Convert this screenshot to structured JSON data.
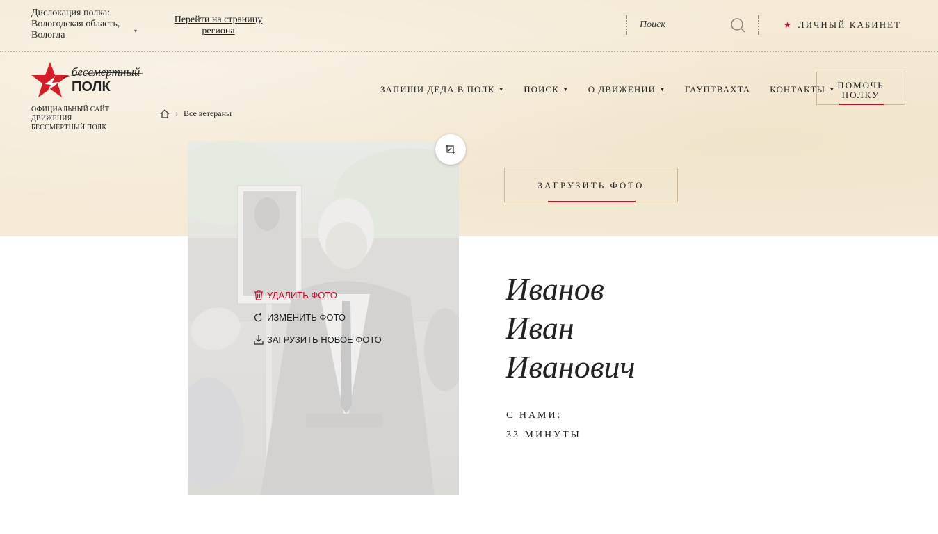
{
  "header": {
    "location_label": "Дислокация полка:",
    "location_value": "Вологодская область, Вологда",
    "region_link": "Перейти на страницу региона",
    "search_placeholder": "Поиск",
    "cabinet": "ЛИЧНЫЙ КАБИНЕТ"
  },
  "logo": {
    "title_line1": "бессмертный",
    "title_line2": "ПОЛК",
    "subtitle_line1": "ОФИЦИАЛЬНЫЙ САЙТ ДВИЖЕНИЯ",
    "subtitle_line2": "БЕССМЕРТНЫЙ ПОЛК"
  },
  "breadcrumb": {
    "current": "Все ветераны"
  },
  "nav": {
    "items": [
      {
        "label": "ЗАПИШИ ДЕДА В ПОЛК",
        "dropdown": true
      },
      {
        "label": "ПОИСК",
        "dropdown": true
      },
      {
        "label": "О ДВИЖЕНИИ",
        "dropdown": true
      },
      {
        "label": "ГАУПТВАХТА",
        "dropdown": false
      },
      {
        "label": "КОНТАКТЫ",
        "dropdown": true
      }
    ],
    "help_line1": "ПОМОЧЬ",
    "help_line2": "ПОЛКУ"
  },
  "photo": {
    "actions": {
      "delete": "УДАЛИТЬ ФОТО",
      "change": "ИЗМЕНИТЬ ФОТО",
      "upload_new": "ЗАГРУЗИТЬ НОВОЕ ФОТО"
    }
  },
  "profile": {
    "upload_button": "ЗАГРУЗИТЬ ФОТО",
    "last_name": "Иванов",
    "first_name": "Иван",
    "patronymic": "Иванович",
    "with_us_label": "С НАМИ:",
    "with_us_value": "33 МИНУТЫ"
  },
  "colors": {
    "accent": "#c8102e",
    "band": "#f4ead6",
    "border": "#cbb79a"
  }
}
